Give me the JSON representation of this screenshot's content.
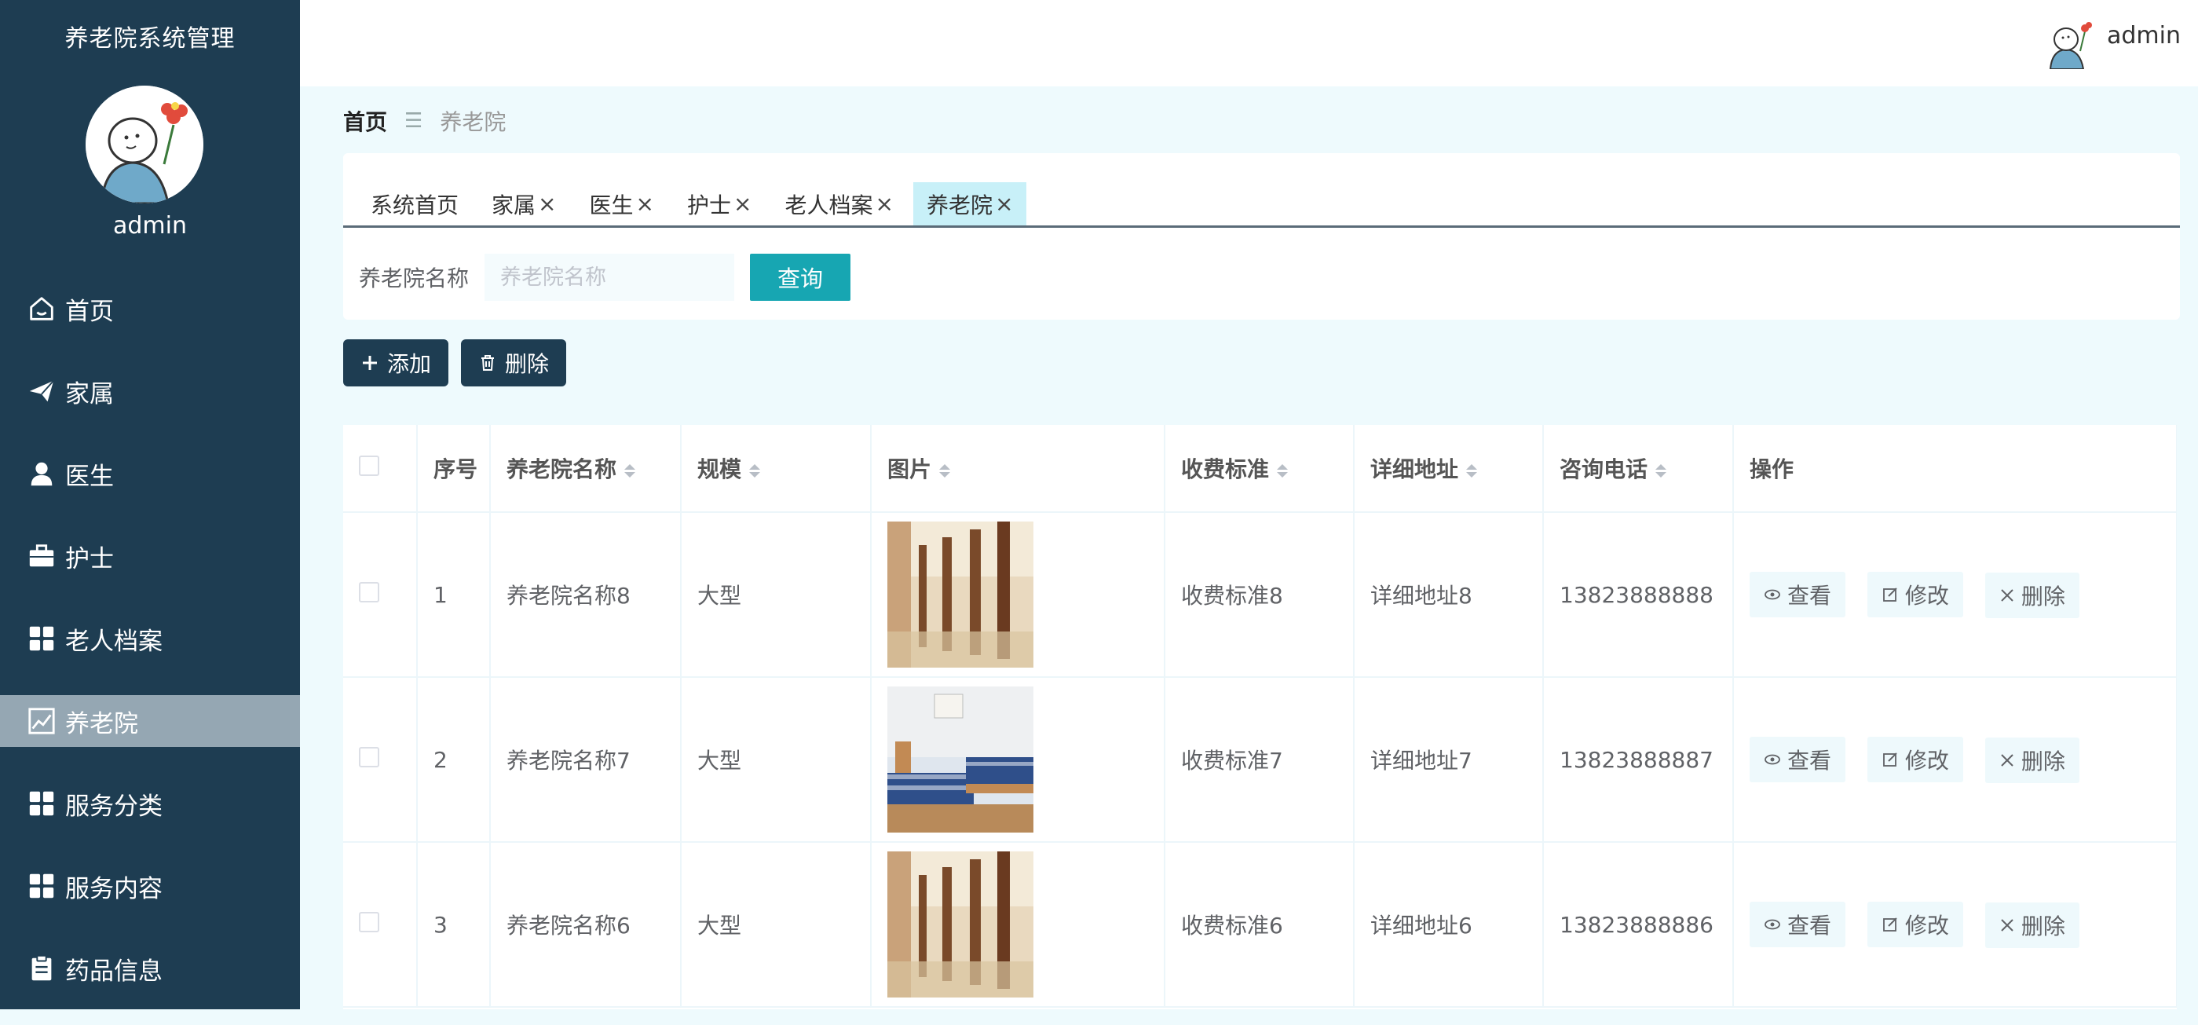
{
  "sidebar": {
    "system_title": "养老院系统管理",
    "username": "admin",
    "items": [
      {
        "label": "首页",
        "icon": "home-icon"
      },
      {
        "label": "家属",
        "icon": "paper-plane-icon"
      },
      {
        "label": "医生",
        "icon": "user-icon"
      },
      {
        "label": "护士",
        "icon": "briefcase-icon"
      },
      {
        "label": "老人档案",
        "icon": "grid-icon"
      },
      {
        "label": "养老院",
        "icon": "chart-icon",
        "active": true
      },
      {
        "label": "服务分类",
        "icon": "grid-icon"
      },
      {
        "label": "服务内容",
        "icon": "grid-icon"
      },
      {
        "label": "药品信息",
        "icon": "clipboard-icon"
      }
    ]
  },
  "topbar": {
    "username": "admin"
  },
  "breadcrumb": {
    "home": "首页",
    "separator": "☰",
    "current": "养老院"
  },
  "tabs": [
    {
      "label": "系统首页",
      "closable": false
    },
    {
      "label": "家属",
      "closable": true
    },
    {
      "label": "医生",
      "closable": true
    },
    {
      "label": "护士",
      "closable": true
    },
    {
      "label": "老人档案",
      "closable": true
    },
    {
      "label": "养老院",
      "closable": true,
      "active": true
    }
  ],
  "search": {
    "label": "养老院名称",
    "placeholder": "养老院名称",
    "value": "",
    "button": "查询"
  },
  "actions": {
    "add": "添加",
    "delete": "删除"
  },
  "table": {
    "headers": {
      "index": "序号",
      "name": "养老院名称",
      "scale": "规模",
      "image": "图片",
      "fee": "收费标准",
      "address": "详细地址",
      "phone": "咨询电话",
      "ops": "操作"
    },
    "rows": [
      {
        "index": "1",
        "name": "养老院名称8",
        "scale": "大型",
        "image": "hall",
        "fee": "收费标准8",
        "address": "详细地址8",
        "phone": "13823888888"
      },
      {
        "index": "2",
        "name": "养老院名称7",
        "scale": "大型",
        "image": "bedroom",
        "fee": "收费标准7",
        "address": "详细地址7",
        "phone": "13823888887"
      },
      {
        "index": "3",
        "name": "养老院名称6",
        "scale": "大型",
        "image": "hall",
        "fee": "收费标准6",
        "address": "详细地址6",
        "phone": "13823888886"
      }
    ],
    "row_ops": {
      "view": "查看",
      "edit": "修改",
      "delete": "删除"
    }
  },
  "colors": {
    "sidebar_bg": "#1e3d52",
    "accent": "#17a6b2",
    "active_menu": "#95a7b3",
    "tab_active": "#c8f0f8",
    "page_bg": "#eefafd"
  }
}
